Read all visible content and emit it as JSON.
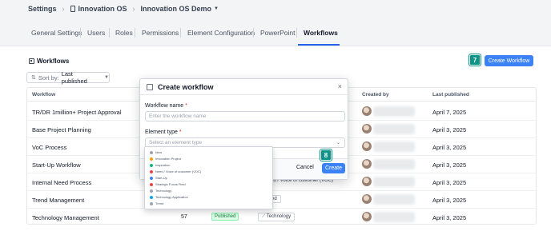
{
  "breadcrumb": {
    "items": [
      "Settings",
      "Innovation OS",
      "Innovation OS Demo"
    ]
  },
  "tabs": [
    {
      "label": "General Settings",
      "active": false
    },
    {
      "label": "Users",
      "active": false
    },
    {
      "label": "Roles",
      "active": false
    },
    {
      "label": "Permissions",
      "active": false
    },
    {
      "label": "Element Configuration",
      "active": false
    },
    {
      "label": "PowerPoint",
      "active": false
    },
    {
      "label": "Workflows",
      "active": true
    }
  ],
  "section": {
    "title": "Workflows"
  },
  "toolbar": {
    "create_label": "Create Workflow",
    "sort_label": "Sort by:",
    "sort_value": "Last published"
  },
  "annotations": {
    "step_create": "7",
    "step_modal_create": "8"
  },
  "table": {
    "headers": {
      "workflow": "Workflow",
      "created_by": "Created by",
      "last_published": "Last published"
    },
    "rows": [
      {
        "name": "TR/DR 1million+ Project Approval",
        "count": "",
        "status": "",
        "element_type": "",
        "date": "April 7, 2025"
      },
      {
        "name": "Base Project Planning",
        "count": "",
        "status": "",
        "element_type": "",
        "date": "April 3, 2025"
      },
      {
        "name": "VoC Process",
        "count": "",
        "status": "",
        "element_type": "",
        "date": "April 3, 2025"
      },
      {
        "name": "Start-Up Workflow",
        "count": "",
        "status": "",
        "element_type": "",
        "date": "April 3, 2025"
      },
      {
        "name": "Internal Need Process",
        "count": "",
        "status": "",
        "element_type": "ed / Voice of customer (VOC)",
        "date": "April 3, 2025"
      },
      {
        "name": "Trend Management",
        "count": "",
        "status": "",
        "element_type": "ed",
        "date": "April 3, 2025"
      },
      {
        "name": "Technology Management",
        "count": "57",
        "status": "Published",
        "element_type": "Technology",
        "date": "April 3, 2025"
      }
    ]
  },
  "modal": {
    "title": "Create workflow",
    "close_glyph": "×",
    "name_label": "Workflow name",
    "name_placeholder": "Enter the workflow name",
    "type_label": "Element type",
    "type_placeholder": "Select an element type",
    "required_mark": "*",
    "cancel_label": "Cancel",
    "create_label": "Create"
  },
  "dropdown": {
    "options": [
      {
        "label": "Idea",
        "color": "#9ca3af"
      },
      {
        "label": "Innovation Project",
        "color": "#f59e0b"
      },
      {
        "label": "Inspiration",
        "color": "#10b981"
      },
      {
        "label": "Need / Voice of customer (VOC)",
        "color": "#ef4444"
      },
      {
        "label": "Start-Up",
        "color": "#3b82f6"
      },
      {
        "label": "Strategic Focus Field",
        "color": "#ef4444"
      },
      {
        "label": "Technology",
        "color": "#9ca3af"
      },
      {
        "label": "Technology Application",
        "color": "#0ea5e9"
      },
      {
        "label": "Trend",
        "color": "#9ca3af"
      }
    ]
  },
  "colors": {
    "accent": "#3b82f6",
    "annotation": "#0d9488",
    "published": "#15803d"
  }
}
